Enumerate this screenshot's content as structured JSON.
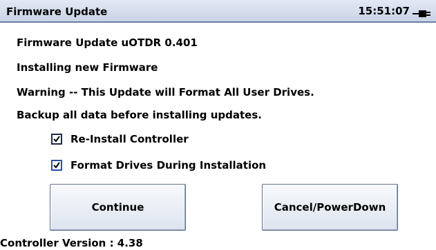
{
  "window": {
    "title": "Firmware Update",
    "time": "15:51:07"
  },
  "info": {
    "line1": "Firmware Update uOTDR 0.401",
    "line2": "Installing new Firmware",
    "line3": "Warning -- This Update will Format All User Drives.",
    "line4": "Backup all data before installing updates."
  },
  "options": {
    "reinstall_label": "Re-Install Controller",
    "reinstall_checked": true,
    "format_label": "Format Drives During Installation",
    "format_checked": true
  },
  "buttons": {
    "continue_label": "Continue",
    "cancel_label": "Cancel/PowerDown"
  },
  "footer": {
    "controller_version": "Controller Version : 4.38"
  },
  "icons": {
    "status": "power-plug-icon"
  },
  "colors": {
    "titlebar": "#d4dcea",
    "checkbox_accent": "#2a4fa8"
  }
}
